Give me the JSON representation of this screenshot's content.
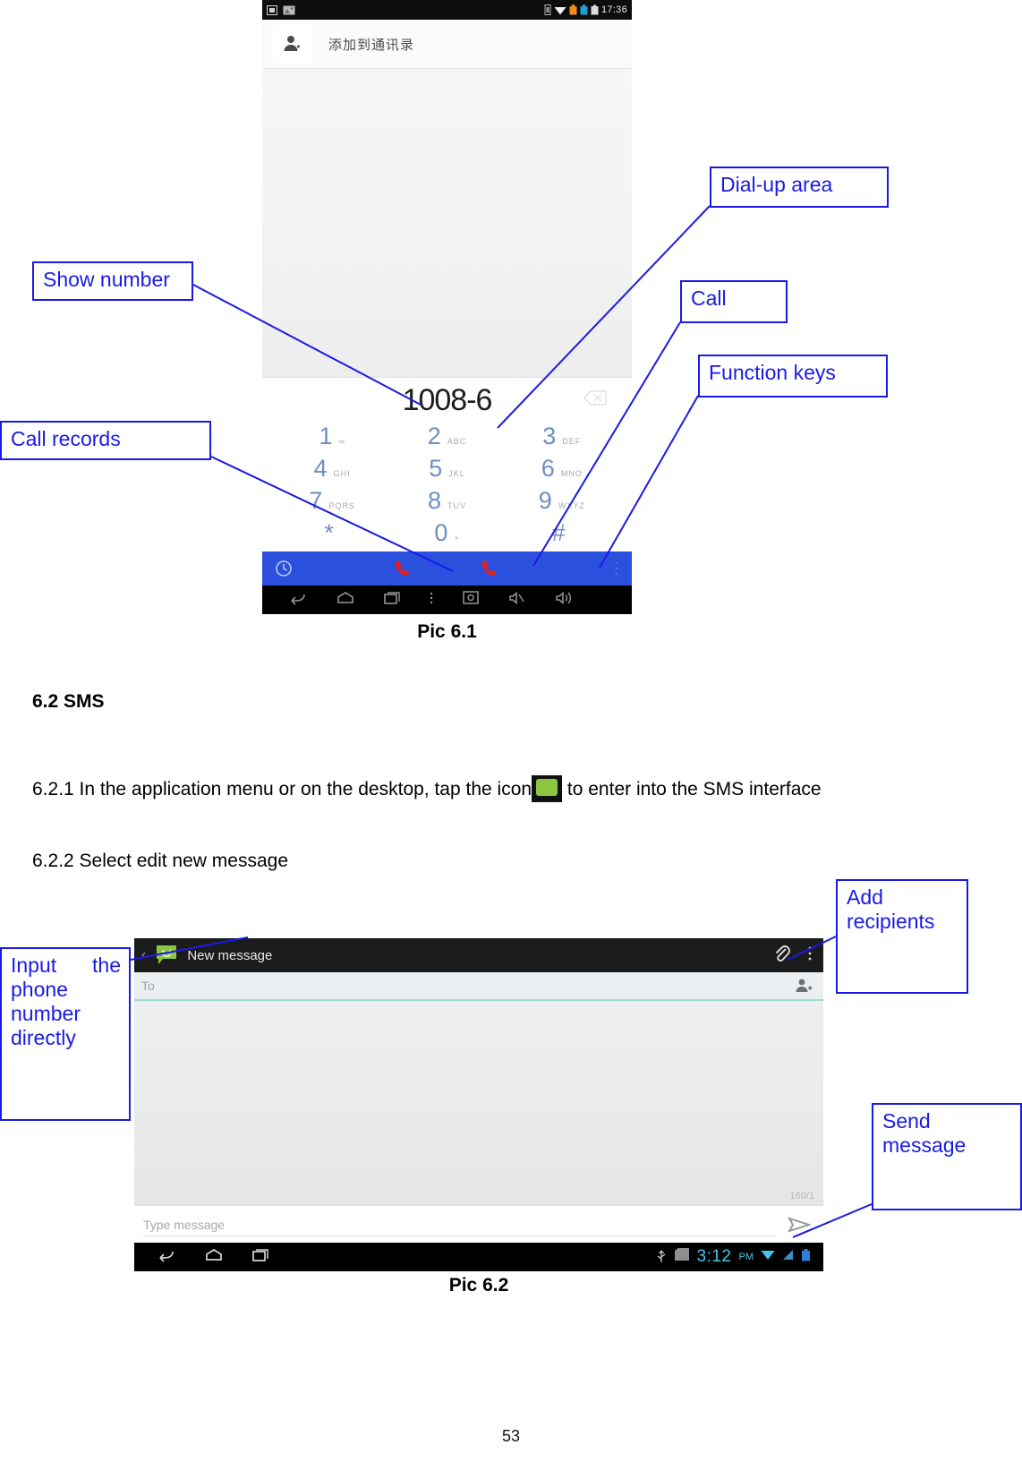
{
  "document": {
    "page_number": "53",
    "section_heading": "6.2 SMS",
    "para_621_before_icon": "6.2.1 In the application menu or on the desktop, tap the icon",
    "para_621_after_icon": "to enter into the SMS interface",
    "para_622": "6.2.2 Select edit new message",
    "caption_61": "Pic 6.1",
    "caption_62": "Pic 6.2",
    "sms_icon_name": "sms-app-icon"
  },
  "callouts": {
    "show_number": "Show number",
    "call_records": "Call records",
    "dial_up_area": "Dial-up area",
    "call": "Call",
    "function_keys": "Function keys",
    "input_phone_number": "Input the phone number directly",
    "add_recipients": "Add recipients",
    "send_message": "Send message"
  },
  "pic61": {
    "statusbar": {
      "time": "17:36",
      "left_icons": [
        "screenshot-icon",
        "picture-icon"
      ],
      "right_icons": [
        "sim-icon",
        "wifi-icon",
        "orange-icon",
        "blue-icon",
        "battery-icon"
      ]
    },
    "add_contact": {
      "icon": "add-person-icon",
      "label": "添加到通讯录"
    },
    "dialed_number": "1008-6",
    "backspace_icon": "backspace-icon",
    "keypad": [
      [
        {
          "digit": "1",
          "sub": "∞"
        },
        {
          "digit": "2",
          "sub": "ABC"
        },
        {
          "digit": "3",
          "sub": "DEF"
        }
      ],
      [
        {
          "digit": "4",
          "sub": "GHI"
        },
        {
          "digit": "5",
          "sub": "JKL"
        },
        {
          "digit": "6",
          "sub": "MNO"
        }
      ],
      [
        {
          "digit": "7",
          "sub": "PQRS"
        },
        {
          "digit": "8",
          "sub": "TUV"
        },
        {
          "digit": "9",
          "sub": "WXYZ"
        }
      ],
      [
        {
          "digit": "*",
          "sub": ""
        },
        {
          "digit": "0",
          "sub": "+"
        },
        {
          "digit": "#",
          "sub": ""
        }
      ]
    ],
    "action_bar": {
      "accent_color": "#2b50dd",
      "call_log_icon": "clock-icon",
      "call1_icon": "phone-call-icon",
      "call2_icon": "phone-call-icon",
      "overflow_icon": "overflow-menu-icon"
    },
    "navbar_icons": [
      "back-icon",
      "home-icon",
      "recents-icon",
      "overflow-menu-icon",
      "screenshot-icon",
      "volume-down-icon",
      "volume-up-icon"
    ]
  },
  "pic62": {
    "titlebar": {
      "back_icon": "back-chevron-icon",
      "app_icon": "sms-app-icon",
      "title": "New message",
      "attach_icon": "paperclip-icon",
      "overflow_icon": "overflow-menu-icon"
    },
    "to_field": {
      "placeholder": "To",
      "value": "",
      "add_contact_icon": "add-person-icon"
    },
    "char_counter": "160/1",
    "compose": {
      "placeholder": "Type message",
      "value": "",
      "send_icon": "send-icon"
    },
    "navbar": {
      "icons": [
        "back-icon",
        "home-icon",
        "recents-icon"
      ],
      "status_icons": [
        "usb-icon",
        "sdcard-icon"
      ],
      "time": "3:12",
      "ampm": "PM",
      "right_icons": [
        "wifi-icon",
        "signal-icon",
        "battery-icon"
      ]
    }
  }
}
